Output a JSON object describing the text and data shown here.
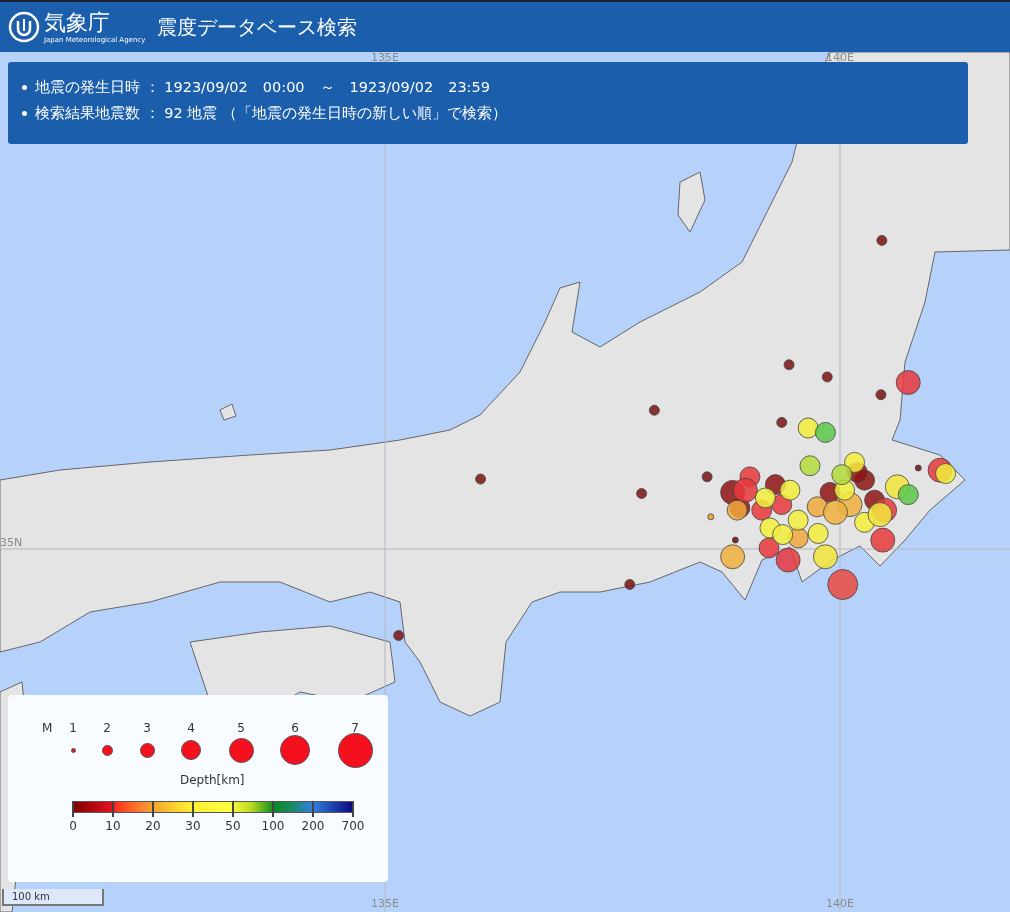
{
  "header": {
    "agency_name": "気象庁",
    "agency_name_en": "Japan Meteorological Agency",
    "title": "震度データベース検索"
  },
  "search_summary": [
    "地震の発生日時 ： 1923/09/02　00:00　～　1923/09/02　23:59",
    "検索結果地震数 ： 92 地震 （「地震の発生日時の新しい順」で検索）"
  ],
  "graticule": {
    "top_labels": [
      "135E",
      "140E"
    ],
    "bottom_labels": [
      "135E",
      "140E"
    ],
    "left_labels": [
      "35N"
    ]
  },
  "legend": {
    "magnitude_label": "M",
    "magnitudes": [
      "1",
      "2",
      "3",
      "4",
      "5",
      "6",
      "7"
    ],
    "depth_title": "Depth[km]",
    "depth_ticks": [
      "0",
      "10",
      "20",
      "30",
      "50",
      "100",
      "200",
      "700"
    ]
  },
  "scale_bar": {
    "label": "100 km"
  }
}
